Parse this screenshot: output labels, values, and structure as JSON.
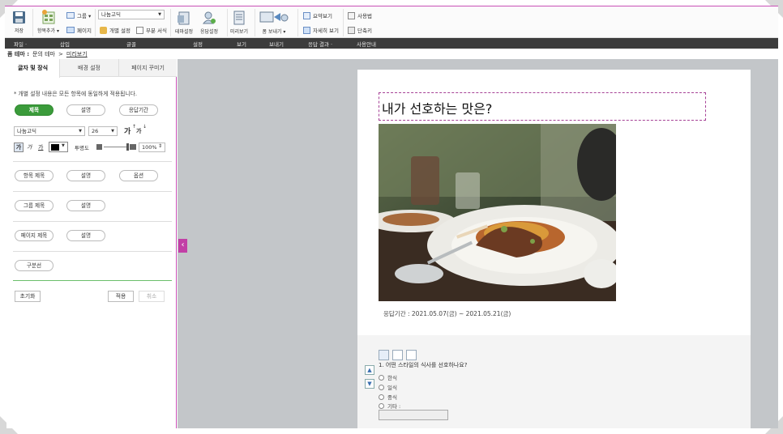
{
  "ribbon": {
    "save": "저장",
    "add_item": "항목추가 ▾",
    "group": "그룹 ▾",
    "page": "페이지",
    "font": "나눔고딕",
    "individual_setting": "개별 설정",
    "partial_format": "부분 서식",
    "theme_setting": "테마설정",
    "response_setting": "응답설정",
    "preview": "미리보기",
    "form_send": "폼 보내기 ▾",
    "summary_view": "요약보기",
    "detail_view": "자세히 보기",
    "user_guide": "사용법",
    "shortcut": "단축키"
  },
  "groups": [
    "파일 ·",
    "삽입",
    "글꼴",
    "설정",
    "보기",
    "보내기",
    "응답 결과 ·",
    "사용안내"
  ],
  "breadcrumb": {
    "label": "폼 테마 :",
    "theme": "문의 테마",
    "sep": ">",
    "link": "미리보기"
  },
  "left_panel": {
    "tabs": [
      "글자 및 장식",
      "배경 설정",
      "페이지 꾸미기"
    ],
    "note": "* 개별 설정 내용은 모든 항목에 동일하게 적용됩니다.",
    "row1": [
      "제목",
      "설명",
      "응답기간"
    ],
    "font_name": "나눔고딕",
    "font_size": "26",
    "bold_glyph": "가",
    "italic_glyph": "가",
    "underline_glyph": "가",
    "grow_glyph": "가",
    "shrink_glyph": "가",
    "opacity_label": "투명도",
    "opacity_value": "100%",
    "row2": [
      "항목 제목",
      "설명",
      "옵션"
    ],
    "row3": [
      "그룹 제목",
      "설명"
    ],
    "row4": [
      "페이지 제목",
      "설명"
    ],
    "row5": [
      "구분선"
    ],
    "reset": "초기화",
    "apply": "적용",
    "cancel": "취소"
  },
  "preview": {
    "title": "내가 선호하는 맛은?",
    "period": "응답기간 : 2021.05.07(금) ~ 2021.05.21(금)",
    "question": "1. 어떤 스타일의 식사를 선호하나요?",
    "options": [
      "한식",
      "일식",
      "중식",
      "기타 :"
    ]
  },
  "colors": {
    "accent": "#c94fb6",
    "green": "#3b9b3b",
    "dark_bar": "#3c3c3c",
    "canvas": "#c3c6c9"
  }
}
